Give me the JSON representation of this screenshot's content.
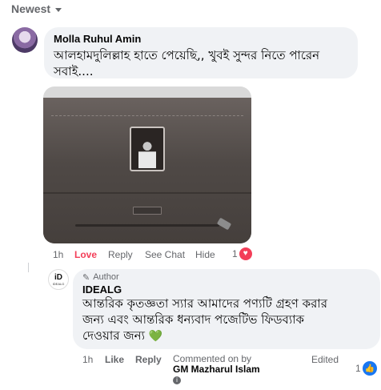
{
  "sort": {
    "label": "Newest"
  },
  "comment1": {
    "author": "Molla Ruhul Amin",
    "text_line1": "আলহামদুলিল্লাহ হাতে পেয়েছি,, খুবই সুন্দর নিতে পারেন",
    "text_line2": "সবাই....",
    "time": "1h",
    "reaction_given": "Love",
    "reply": "Reply",
    "see_chat": "See Chat",
    "hide": "Hide",
    "reaction_count": "1",
    "id_plate_text": "I D E A L G"
  },
  "reply": {
    "avatar_logo": "iD",
    "avatar_sub": "IDEALG",
    "badge": "Author",
    "author": "IDEALG",
    "text_line1": "আন্তরিক কৃতজ্ঞতা স্যার আমাদের পণ্যটি গ্রহণ করার",
    "text_line2": "জন্য এবং আন্তরিক ধন্যবাদ পজেটিভ ফিডব্যাক",
    "text_line3": "দেওয়ার জন্য",
    "time": "1h",
    "like": "Like",
    "reply": "Reply",
    "commented_on_by": "Commented on by",
    "commenter_name": "GM Mazharul Islam",
    "edited": "Edited",
    "reaction_count": "1"
  },
  "colors": {
    "bubble": "#f0f2f5",
    "secondary_text": "#65676b",
    "love": "#f33e58",
    "like": "#1877f2",
    "green_heart": "#31a24c"
  },
  "icons": [
    "caret-down-icon",
    "love-reaction-icon",
    "pencil-icon",
    "green-heart-icon",
    "info-icon",
    "like-reaction-icon"
  ]
}
